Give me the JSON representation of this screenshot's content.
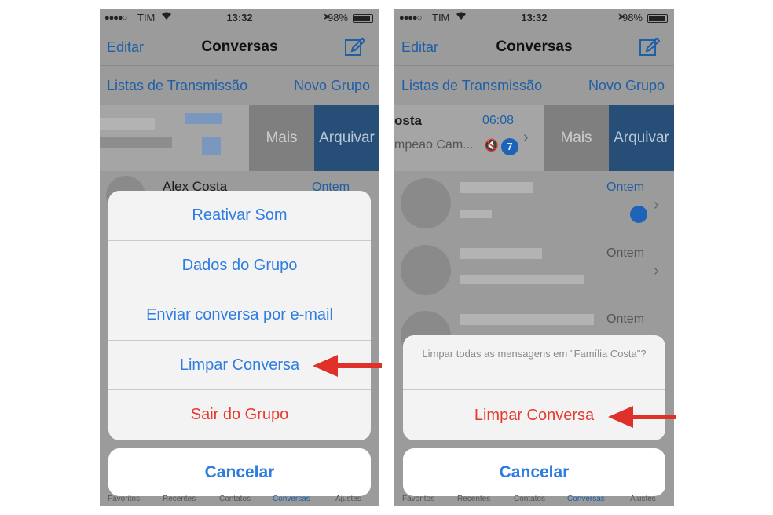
{
  "status": {
    "carrier": "TIM",
    "time": "13:32",
    "battery": "98%"
  },
  "nav": {
    "edit": "Editar",
    "title": "Conversas"
  },
  "lists": {
    "broadcast": "Listas de Transmissão",
    "new_group": "Novo Grupo"
  },
  "swipe": {
    "more": "Mais",
    "archive": "Arquivar"
  },
  "left": {
    "row_name": "Alex Costa",
    "row_time": "Ontem",
    "actions": [
      "Reativar Som",
      "Dados do Grupo",
      "Enviar conversa por e-mail",
      "Limpar Conversa",
      "Sair do Grupo"
    ],
    "cancel": "Cancelar"
  },
  "right": {
    "chat_name": "osta",
    "chat_time": "06:08",
    "chat_preview": "mpeao Cam...",
    "unread": "7",
    "row_times": [
      "Ontem",
      "Ontem",
      "Ontem"
    ],
    "confirm_message": "Limpar todas as mensagens em \"Família Costa\"?",
    "confirm_action": "Limpar Conversa",
    "cancel": "Cancelar"
  },
  "tabs": [
    "Favoritos",
    "Recentes",
    "Contatos",
    "Conversas",
    "Ajustes"
  ],
  "colors": {
    "ios_blue": "#2e7de0",
    "destructive": "#e63a2e",
    "archive": "#274e76",
    "arrow": "#e0302a"
  }
}
